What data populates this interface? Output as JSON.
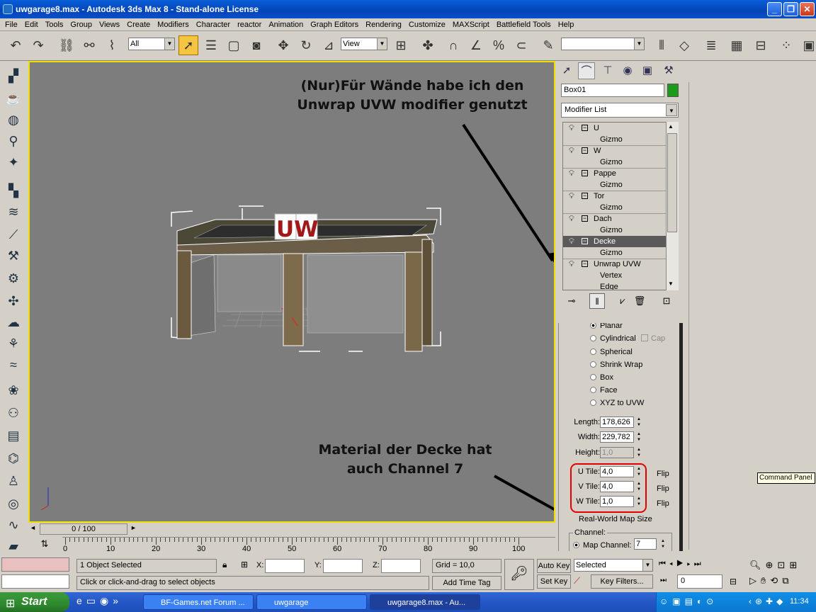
{
  "window": {
    "title": "uwgarage8.max - Autodesk 3ds Max 8 - Stand-alone License",
    "btn_min": "_",
    "btn_max": "❐",
    "btn_close": "✕"
  },
  "menu": [
    "File",
    "Edit",
    "Tools",
    "Group",
    "Views",
    "Create",
    "Modifiers",
    "Character",
    "reactor",
    "Animation",
    "Graph Editors",
    "Rendering",
    "Customize",
    "MAXScript",
    "Battlefield Tools",
    "Help"
  ],
  "toolbar": {
    "selection_filter": "All",
    "ref_coord": "View",
    "named_sel": ""
  },
  "command_panel": {
    "object_name": "Box01",
    "object_color": "#1c9a1c",
    "modifier_list": "Modifier List",
    "stack": [
      {
        "label": "U",
        "sub": "Gizmo"
      },
      {
        "label": "W",
        "sub": "Gizmo"
      },
      {
        "label": "Pappe",
        "sub": "Gizmo"
      },
      {
        "label": "Tor",
        "sub": "Gizmo"
      },
      {
        "label": "Dach",
        "sub": "Gizmo"
      },
      {
        "label": "Decke",
        "sub": "Gizmo",
        "selected": true
      },
      {
        "label": "Unwrap UVW",
        "sub": "Vertex",
        "sub2": "Edge"
      }
    ],
    "mapping": {
      "planar": "Planar",
      "cylindrical": "Cylindrical",
      "cap": "Cap",
      "spherical": "Spherical",
      "shrink_wrap": "Shrink Wrap",
      "box": "Box",
      "face": "Face",
      "xyz": "XYZ to UVW"
    },
    "length_label": "Length:",
    "length": "178,626",
    "width_label": "Width:",
    "width": "229,782",
    "height_label": "Height:",
    "height": "1,0",
    "utile_label": "U Tile:",
    "utile": "4,0",
    "vtile_label": "V Tile:",
    "vtile": "4,0",
    "wtile_label": "W Tile:",
    "wtile": "1,0",
    "flip": "Flip",
    "realworld": "Real-World Map Size",
    "channel_group": "Channel:",
    "map_channel_label": "Map Channel:",
    "map_channel": "7"
  },
  "tooltip": "Command Panel",
  "annotations": {
    "top_line1": "(Nur)Für Wände habe ich den",
    "top_line2": "Unwrap UVW modifier genutzt",
    "bottom_line1": "Material der Decke hat",
    "bottom_line2": "auch Channel 7"
  },
  "viewport": {
    "logo": "UW"
  },
  "timeline": {
    "frame": "0 / 100",
    "ticks": [
      "0",
      "10",
      "20",
      "30",
      "40",
      "50",
      "60",
      "70",
      "80",
      "90",
      "100"
    ]
  },
  "status": {
    "selected": "1 Object Selected",
    "prompt": "Click or click-and-drag to select objects",
    "x_label": "X:",
    "y_label": "Y:",
    "z_label": "Z:",
    "grid": "Grid = 10,0",
    "add_time_tag": "Add Time Tag",
    "auto_key": "Auto Key",
    "set_key": "Set Key",
    "key_mode": "Selected",
    "key_filters": "Key Filters...",
    "frame_field": "0"
  },
  "taskbar": {
    "start": "Start",
    "tasks": [
      "BF-Games.net Forum ...",
      "uwgarage",
      "uwgarage8.max - Au..."
    ],
    "clock": "11:34"
  }
}
